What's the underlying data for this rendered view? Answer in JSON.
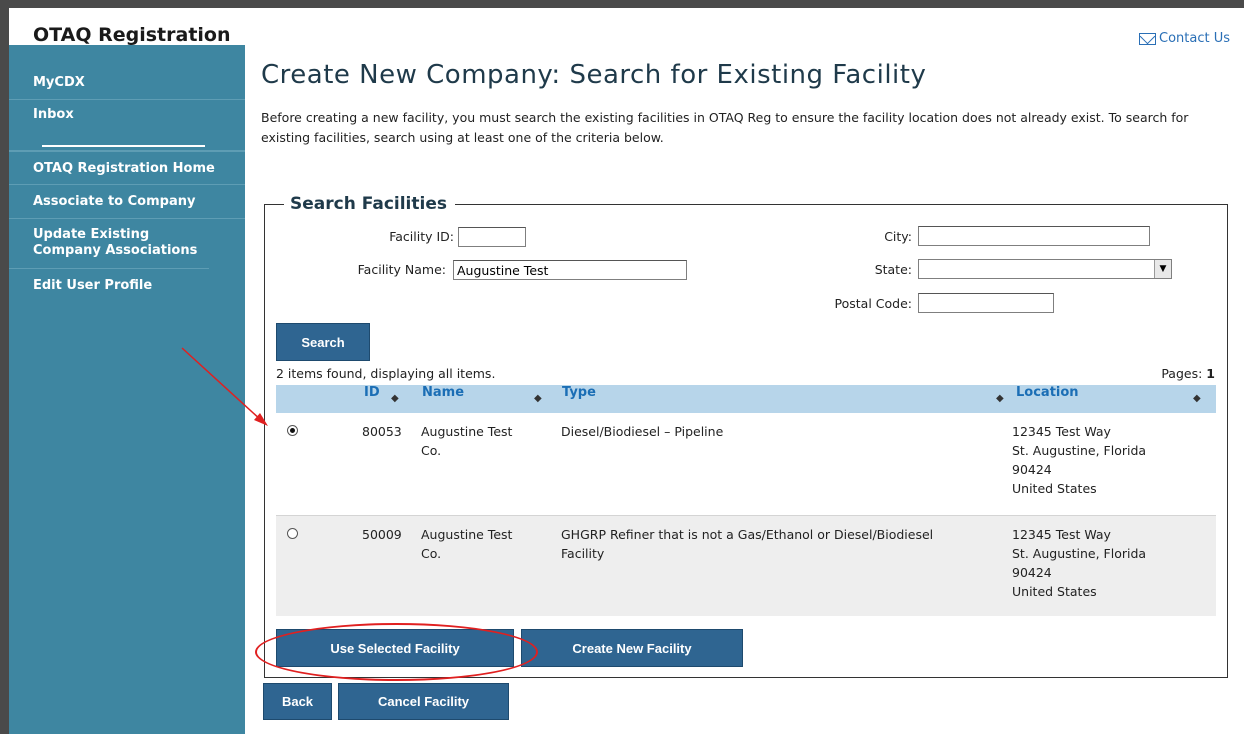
{
  "app": {
    "title": "OTAQ Registration"
  },
  "header": {
    "contact_label": "Contact Us"
  },
  "sidebar": {
    "items": [
      {
        "label": "MyCDX"
      },
      {
        "label": "Inbox"
      },
      {
        "label": "OTAQ Registration Home"
      },
      {
        "label": "Associate to Company"
      },
      {
        "label": "Update Existing Company Associations"
      },
      {
        "label": "Edit User Profile"
      }
    ]
  },
  "page": {
    "title": "Create New Company: Search for Existing Facility",
    "intro": "Before creating a new facility, you must search the existing facilities in OTAQ Reg to ensure the facility location does not already exist. To search for existing facilities, search using at least one of the criteria below."
  },
  "search": {
    "legend": "Search Facilities",
    "facility_id_label": "Facility ID:",
    "facility_id_value": "",
    "facility_name_label": "Facility Name:",
    "facility_name_value": "Augustine Test",
    "city_label": "City:",
    "city_value": "",
    "state_label": "State:",
    "state_value": "",
    "postal_label": "Postal Code:",
    "postal_value": "",
    "search_button": "Search"
  },
  "results": {
    "summary": "2 items found, displaying all items.",
    "pages_label": "Pages:",
    "pages_value": "1",
    "columns": [
      "ID",
      "Name",
      "Type",
      "Location"
    ],
    "rows": [
      {
        "selected": true,
        "id": "80053",
        "name_line1": "Augustine Test",
        "name_line2": "Co.",
        "type_line1": "Diesel/Biodiesel – Pipeline",
        "type_line2": "",
        "loc_line1": "12345 Test Way",
        "loc_line2": "St. Augustine, Florida",
        "loc_line3": "90424",
        "loc_line4": "United States"
      },
      {
        "selected": false,
        "id": "50009",
        "name_line1": "Augustine Test",
        "name_line2": "Co.",
        "type_line1": "GHGRP Refiner that is not a Gas/Ethanol or Diesel/Biodiesel",
        "type_line2": "Facility",
        "loc_line1": "12345 Test Way",
        "loc_line2": "St. Augustine, Florida",
        "loc_line3": "90424",
        "loc_line4": "United States"
      }
    ]
  },
  "actions": {
    "use_selected": "Use Selected Facility",
    "create_new": "Create New Facility",
    "back": "Back",
    "cancel": "Cancel Facility"
  },
  "colors": {
    "sidebar": "#3e86a1",
    "button": "#2f6591",
    "table_header": "#b7d5ea",
    "link": "#1b6eb5",
    "annotation": "#e02020"
  }
}
